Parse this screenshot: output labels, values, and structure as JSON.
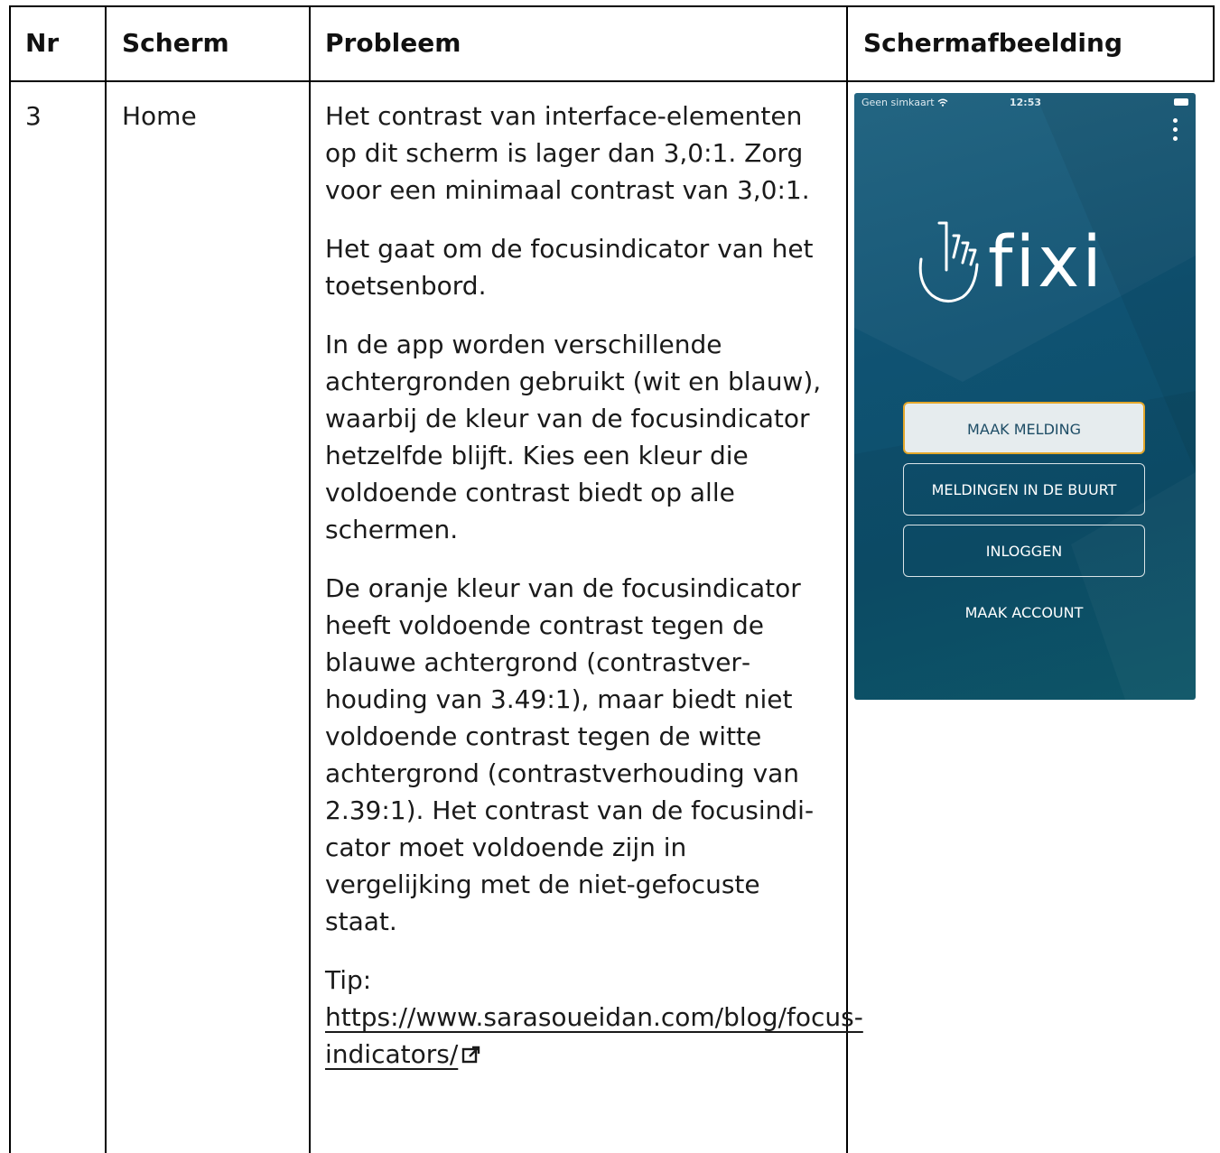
{
  "table": {
    "headers": [
      "Nr",
      "Scherm",
      "Probleem",
      "Schermafbeelding"
    ],
    "row": {
      "nr": "3",
      "scherm": "Home",
      "probleem": [
        "Het contrast van interface-elementen op dit scherm is lager dan 3,0:1. Zorg voor een minimaal contrast van 3,0:1.",
        "Het gaat om de focusindicator van het toetsenbord.",
        "In de app worden verschillende achtergronden gebruikt (wit en blauw), waarbij de kleur van de fo­cusindicator hetzelfde blijft. Kies een kleur die voldoende contrast biedt op alle schermen.",
        "De oranje kleur van de focusindicator heeft voldoende contrast tegen de blauwe achtergrond (contrastver­houding van 3.49:1), maar biedt niet voldoende contrast tegen de witte achtergrond (contrastverhouding van 2.39:1). Het contrast van de focusindi­cator moet voldoende zijn in vergelijking met de niet-gefocuste staat."
      ],
      "tip_label": "Tip: ",
      "tip_link": "https://www.sarasoueidan.com/blog/focus-indicators/"
    }
  },
  "screenshot": {
    "status_carrier": "Geen simkaart",
    "status_time": "12:53",
    "app_name": "fixi",
    "buttons": [
      "MAAK MELDING",
      "MELDINGEN IN DE BUURT",
      "INLOGGEN",
      "MAAK ACCOUNT"
    ],
    "colors": {
      "background": "#0f5272",
      "focus_outline": "#e3a72b",
      "focused_button_bg": "#e6ecee"
    },
    "icons": [
      "wifi-icon",
      "battery-icon",
      "more-vertical-icon",
      "fixi-hand-logo-icon"
    ]
  }
}
